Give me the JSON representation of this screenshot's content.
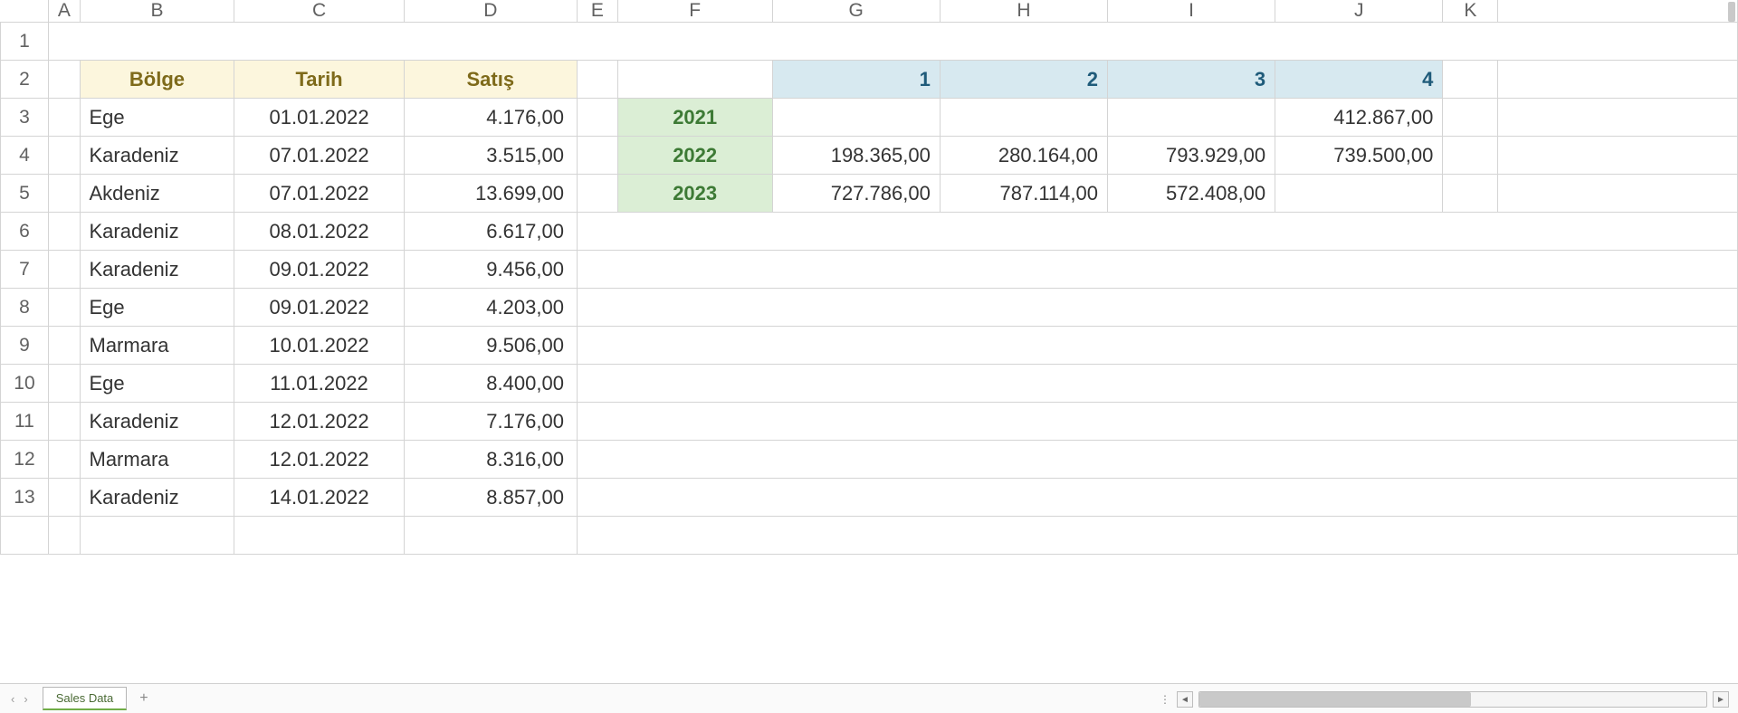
{
  "columns": [
    "A",
    "B",
    "C",
    "D",
    "E",
    "F",
    "G",
    "H",
    "I",
    "J",
    "K"
  ],
  "rows": [
    "1",
    "2",
    "3",
    "4",
    "5",
    "6",
    "7",
    "8",
    "9",
    "10",
    "11",
    "12",
    "13"
  ],
  "table1": {
    "headers": {
      "region": "Bölge",
      "date": "Tarih",
      "sales": "Satış"
    },
    "rows": [
      {
        "region": "Ege",
        "date": "01.01.2022",
        "sales": "4.176,00"
      },
      {
        "region": "Karadeniz",
        "date": "07.01.2022",
        "sales": "3.515,00"
      },
      {
        "region": "Akdeniz",
        "date": "07.01.2022",
        "sales": "13.699,00"
      },
      {
        "region": "Karadeniz",
        "date": "08.01.2022",
        "sales": "6.617,00"
      },
      {
        "region": "Karadeniz",
        "date": "09.01.2022",
        "sales": "9.456,00"
      },
      {
        "region": "Ege",
        "date": "09.01.2022",
        "sales": "4.203,00"
      },
      {
        "region": "Marmara",
        "date": "10.01.2022",
        "sales": "9.506,00"
      },
      {
        "region": "Ege",
        "date": "11.01.2022",
        "sales": "8.400,00"
      },
      {
        "region": "Karadeniz",
        "date": "12.01.2022",
        "sales": "7.176,00"
      },
      {
        "region": "Marmara",
        "date": "12.01.2022",
        "sales": "8.316,00"
      },
      {
        "region": "Karadeniz",
        "date": "14.01.2022",
        "sales": "8.857,00"
      }
    ]
  },
  "table2": {
    "col_headers": [
      "1",
      "2",
      "3",
      "4"
    ],
    "rows": [
      {
        "year": "2021",
        "vals": [
          "",
          "",
          "",
          "412.867,00"
        ]
      },
      {
        "year": "2022",
        "vals": [
          "198.365,00",
          "280.164,00",
          "793.929,00",
          "739.500,00"
        ]
      },
      {
        "year": "2023",
        "vals": [
          "727.786,00",
          "787.114,00",
          "572.408,00",
          ""
        ]
      }
    ]
  },
  "sheet_tab": "Sales Data",
  "add_tab_glyph": "+"
}
